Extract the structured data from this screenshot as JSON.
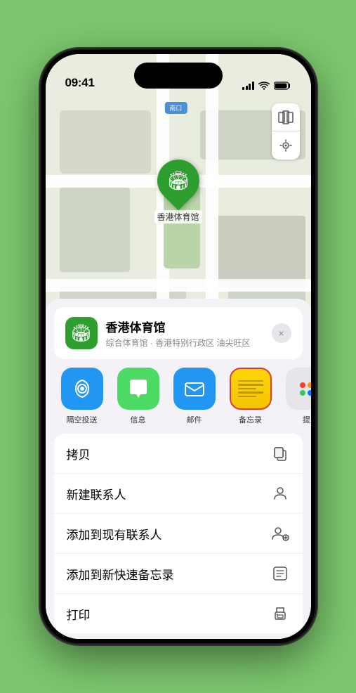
{
  "status_bar": {
    "time": "09:41",
    "location_icon": "▶"
  },
  "map": {
    "label_text": "南口",
    "pin_name": "香港体育馆",
    "pin_emoji": "🏟"
  },
  "map_controls": {
    "map_icon": "🗺",
    "location_icon": "➤"
  },
  "location_card": {
    "name": "香港体育馆",
    "subtitle": "综合体育馆 · 香港特别行政区 油尖旺区",
    "close_label": "×"
  },
  "share_items": [
    {
      "id": "airdrop",
      "label": "隔空投送",
      "style": "airdrop"
    },
    {
      "id": "messages",
      "label": "信息",
      "style": "messages"
    },
    {
      "id": "mail",
      "label": "邮件",
      "style": "mail"
    },
    {
      "id": "notes",
      "label": "备忘录",
      "style": "notes"
    },
    {
      "id": "more",
      "label": "提",
      "style": "more"
    }
  ],
  "action_items": [
    {
      "id": "copy",
      "label": "拷贝"
    },
    {
      "id": "new-contact",
      "label": "新建联系人"
    },
    {
      "id": "add-existing",
      "label": "添加到现有联系人"
    },
    {
      "id": "add-notes",
      "label": "添加到新快速备忘录"
    },
    {
      "id": "print",
      "label": "打印"
    }
  ]
}
